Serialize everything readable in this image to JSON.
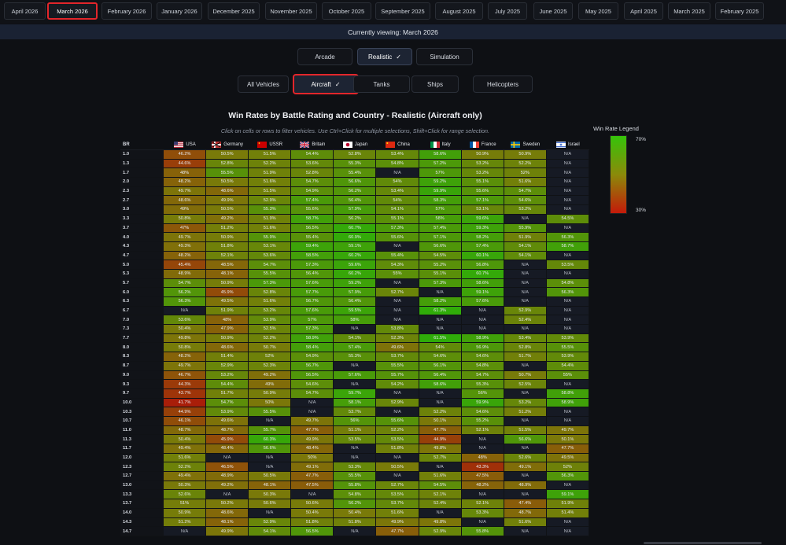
{
  "months": [
    "April 2026",
    "March 2026",
    "February 2026",
    "January 2026",
    "December 2025",
    "November 2025",
    "October 2025",
    "September 2025",
    "August 2025",
    "July 2025",
    "June 2025",
    "May 2025",
    "April 2025",
    "March 2025",
    "February 2025"
  ],
  "active_month_index": 1,
  "viewing_text": "Currently viewing: March 2026",
  "modes": [
    "Arcade",
    "Realistic",
    "Simulation"
  ],
  "active_mode_index": 1,
  "vehicle_types": [
    "All Vehicles",
    "Aircraft",
    "Tanks",
    "Ships",
    "Helicopters"
  ],
  "active_vehicle_index": 1,
  "check_glyph": "✓",
  "title": "Win Rates by Battle Rating and Country - Realistic (Aircraft only)",
  "hint": "Click on cells or rows to filter vehicles. Use Ctrl+Click for multiple selections, Shift+Click for range selection.",
  "legend": {
    "title": "Win Rate Legend",
    "max": "70%",
    "min": "30%",
    "colors": [
      "#35c40a",
      "#8b8a0a",
      "#c41a0a"
    ]
  },
  "table": {
    "br_header": "BR",
    "countries": [
      {
        "name": "USA",
        "flag": "usa-flag"
      },
      {
        "name": "Germany",
        "flag": "germany-flag"
      },
      {
        "name": "USSR",
        "flag": "ussr-flag"
      },
      {
        "name": "Britain",
        "flag": "britain-flag"
      },
      {
        "name": "Japan",
        "flag": "japan-flag"
      },
      {
        "name": "China",
        "flag": "china-flag"
      },
      {
        "name": "Italy",
        "flag": "italy-flag"
      },
      {
        "name": "France",
        "flag": "france-flag"
      },
      {
        "name": "Sweden",
        "flag": "sweden-flag"
      },
      {
        "name": "Israel",
        "flag": "israel-flag"
      }
    ],
    "rows": [
      {
        "br": "1.0",
        "values": [
          "46.2%",
          "50.5%",
          "51.5%",
          "54.4%",
          "52.8%",
          "53.4%",
          "58.6%",
          "50.9%",
          "50.9%",
          "N/A"
        ]
      },
      {
        "br": "1.3",
        "values": [
          "44.6%",
          "52.8%",
          "52.2%",
          "53.6%",
          "55.3%",
          "54.8%",
          "57.2%",
          "53.2%",
          "52.2%",
          "N/A"
        ]
      },
      {
        "br": "1.7",
        "values": [
          "48%",
          "55.5%",
          "51.9%",
          "52.8%",
          "55.4%",
          "N/A",
          "57%",
          "53.2%",
          "52%",
          "N/A"
        ]
      },
      {
        "br": "2.0",
        "values": [
          "48.2%",
          "50.5%",
          "51.6%",
          "54.7%",
          "56.6%",
          "54%",
          "59.2%",
          "55.1%",
          "51.6%",
          "N/A"
        ]
      },
      {
        "br": "2.3",
        "values": [
          "49.7%",
          "48.6%",
          "51.5%",
          "54.9%",
          "56.2%",
          "53.4%",
          "59.9%",
          "55.6%",
          "54.7%",
          "N/A"
        ]
      },
      {
        "br": "2.7",
        "values": [
          "48.6%",
          "49.9%",
          "52.9%",
          "57.4%",
          "56.4%",
          "54%",
          "58.3%",
          "57.1%",
          "54.6%",
          "N/A"
        ]
      },
      {
        "br": "3.0",
        "values": [
          "49%",
          "50.5%",
          "55.3%",
          "55.6%",
          "57.9%",
          "54.1%",
          "57%",
          "53.1%",
          "53.2%",
          "N/A"
        ]
      },
      {
        "br": "3.3",
        "values": [
          "50.8%",
          "49.2%",
          "51.9%",
          "58.7%",
          "56.2%",
          "55.1%",
          "58%",
          "59.6%",
          "N/A",
          "54.5%"
        ]
      },
      {
        "br": "3.7",
        "values": [
          "47%",
          "51.2%",
          "51.6%",
          "56.5%",
          "60.7%",
          "57.3%",
          "57.4%",
          "59.3%",
          "55.9%",
          "N/A"
        ]
      },
      {
        "br": "4.0",
        "values": [
          "49.7%",
          "50.9%",
          "55.9%",
          "55.4%",
          "60.9%",
          "55.6%",
          "57.1%",
          "58.2%",
          "51.9%",
          "56.3%"
        ]
      },
      {
        "br": "4.3",
        "values": [
          "49.3%",
          "51.8%",
          "53.1%",
          "59.4%",
          "59.1%",
          "N/A",
          "56.6%",
          "57.4%",
          "54.1%",
          "58.7%"
        ]
      },
      {
        "br": "4.7",
        "values": [
          "48.2%",
          "52.1%",
          "53.6%",
          "58.5%",
          "60.2%",
          "55.4%",
          "54.5%",
          "60.1%",
          "54.1%",
          "N/A"
        ]
      },
      {
        "br": "5.0",
        "values": [
          "45.4%",
          "48.5%",
          "54.7%",
          "57.3%",
          "59.6%",
          "54.3%",
          "55.2%",
          "56.8%",
          "N/A",
          "53.5%"
        ]
      },
      {
        "br": "5.3",
        "values": [
          "48.9%",
          "48.1%",
          "55.5%",
          "56.4%",
          "60.2%",
          "55%",
          "55.1%",
          "60.7%",
          "N/A",
          "N/A"
        ]
      },
      {
        "br": "5.7",
        "values": [
          "54.7%",
          "50.9%",
          "57.3%",
          "57.6%",
          "59.2%",
          "N/A",
          "57.3%",
          "58.6%",
          "N/A",
          "54.8%"
        ]
      },
      {
        "br": "6.0",
        "values": [
          "56.2%",
          "45.9%",
          "52.8%",
          "57.7%",
          "57.9%",
          "52.7%",
          "N/A",
          "59.1%",
          "N/A",
          "56.3%"
        ]
      },
      {
        "br": "6.3",
        "values": [
          "56.3%",
          "49.5%",
          "51.6%",
          "56.7%",
          "56.4%",
          "N/A",
          "58.2%",
          "57.6%",
          "N/A",
          "N/A"
        ]
      },
      {
        "br": "6.7",
        "values": [
          "N/A",
          "51.9%",
          "53.2%",
          "57.6%",
          "59.5%",
          "N/A",
          "61.3%",
          "N/A",
          "52.9%",
          "N/A"
        ]
      },
      {
        "br": "7.0",
        "values": [
          "53.6%",
          "48%",
          "53.9%",
          "57%",
          "58%",
          "N/A",
          "N/A",
          "N/A",
          "52.4%",
          "N/A"
        ]
      },
      {
        "br": "7.3",
        "values": [
          "50.4%",
          "47.9%",
          "52.5%",
          "57.3%",
          "N/A",
          "53.8%",
          "N/A",
          "N/A",
          "N/A",
          "N/A"
        ]
      },
      {
        "br": "7.7",
        "values": [
          "49.8%",
          "50.9%",
          "52.2%",
          "58.9%",
          "54.1%",
          "52.3%",
          "61.5%",
          "58.9%",
          "53.4%",
          "53.9%"
        ]
      },
      {
        "br": "8.0",
        "values": [
          "50.8%",
          "48.6%",
          "50.7%",
          "58.4%",
          "57.4%",
          "49.6%",
          "54%",
          "56.9%",
          "52.8%",
          "55.5%"
        ]
      },
      {
        "br": "8.3",
        "values": [
          "48.2%",
          "51.4%",
          "52%",
          "54.9%",
          "55.3%",
          "53.7%",
          "54.6%",
          "54.6%",
          "51.7%",
          "53.9%"
        ]
      },
      {
        "br": "8.7",
        "values": [
          "49.7%",
          "52.9%",
          "52.3%",
          "56.7%",
          "N/A",
          "55.5%",
          "56.1%",
          "54.8%",
          "N/A",
          "54.4%"
        ]
      },
      {
        "br": "9.0",
        "values": [
          "46.7%",
          "53.2%",
          "49.2%",
          "56.5%",
          "57.6%",
          "55.7%",
          "56.4%",
          "54.7%",
          "50.7%",
          "55%"
        ]
      },
      {
        "br": "9.3",
        "values": [
          "44.3%",
          "54.4%",
          "49%",
          "54.6%",
          "N/A",
          "54.2%",
          "58.6%",
          "55.3%",
          "52.5%",
          "N/A"
        ]
      },
      {
        "br": "9.7",
        "values": [
          "43.7%",
          "51.7%",
          "50.9%",
          "54.7%",
          "59.7%",
          "N/A",
          "N/A",
          "56%",
          "N/A",
          "58.8%"
        ]
      },
      {
        "br": "10.0",
        "values": [
          "41.7%",
          "54.7%",
          "50%",
          "N/A",
          "58.1%",
          "52.9%",
          "N/A",
          "59.9%",
          "53.2%",
          "58.9%"
        ]
      },
      {
        "br": "10.3",
        "values": [
          "44.9%",
          "53.9%",
          "55.5%",
          "N/A",
          "53.7%",
          "N/A",
          "52.2%",
          "54.6%",
          "51.2%",
          "N/A"
        ]
      },
      {
        "br": "10.7",
        "values": [
          "46.1%",
          "49.6%",
          "N/A",
          "49.7%",
          "56%",
          "55.6%",
          "50.1%",
          "55.2%",
          "N/A",
          "N/A"
        ]
      },
      {
        "br": "11.0",
        "values": [
          "48.7%",
          "48.7%",
          "55.7%",
          "47.7%",
          "51.1%",
          "52.2%",
          "47.7%",
          "52.1%",
          "51.5%",
          "49.7%"
        ]
      },
      {
        "br": "11.3",
        "values": [
          "50.4%",
          "45.9%",
          "60.3%",
          "49.9%",
          "53.5%",
          "53.5%",
          "44.9%",
          "N/A",
          "56.6%",
          "50.1%"
        ]
      },
      {
        "br": "11.7",
        "values": [
          "49.4%",
          "48.4%",
          "56.6%",
          "48.4%",
          "N/A",
          "51.8%",
          "49.8%",
          "N/A",
          "N/A",
          "47.7%"
        ]
      },
      {
        "br": "12.0",
        "values": [
          "51.6%",
          "N/A",
          "N/A",
          "50%",
          "N/A",
          "N/A",
          "52.7%",
          "48%",
          "52.6%",
          "49.5%"
        ]
      },
      {
        "br": "12.3",
        "values": [
          "52.2%",
          "46.5%",
          "N/A",
          "49.1%",
          "53.3%",
          "50.5%",
          "N/A",
          "43.3%",
          "49.1%",
          "52%"
        ]
      },
      {
        "br": "12.7",
        "values": [
          "49.4%",
          "48.9%",
          "50.5%",
          "47.7%",
          "55.5%",
          "N/A",
          "51.6%",
          "47.5%",
          "N/A",
          "56.3%"
        ]
      },
      {
        "br": "13.0",
        "values": [
          "50.3%",
          "49.2%",
          "48.1%",
          "47.5%",
          "55.8%",
          "52.7%",
          "54.5%",
          "48.2%",
          "48.9%",
          "N/A"
        ]
      },
      {
        "br": "13.3",
        "values": [
          "52.6%",
          "N/A",
          "50.3%",
          "N/A",
          "54.8%",
          "53.5%",
          "52.1%",
          "N/A",
          "N/A",
          "59.1%"
        ]
      },
      {
        "br": "13.7",
        "values": [
          "51%",
          "50.2%",
          "50.6%",
          "50.6%",
          "56.2%",
          "53.7%",
          "52.4%",
          "52.1%",
          "47.4%",
          "51.9%"
        ]
      },
      {
        "br": "14.0",
        "values": [
          "50.9%",
          "48.6%",
          "N/A",
          "50.4%",
          "50.4%",
          "51.6%",
          "N/A",
          "53.3%",
          "48.7%",
          "51.4%"
        ]
      },
      {
        "br": "14.3",
        "values": [
          "51.2%",
          "48.1%",
          "52.9%",
          "51.8%",
          "51.8%",
          "49.9%",
          "49.8%",
          "N/A",
          "51.6%",
          "N/A"
        ]
      },
      {
        "br": "14.7",
        "values": [
          "N/A",
          "49.9%",
          "54.1%",
          "56.5%",
          "N/A",
          "47.7%",
          "52.9%",
          "55.8%",
          "N/A",
          "N/A"
        ]
      }
    ]
  }
}
